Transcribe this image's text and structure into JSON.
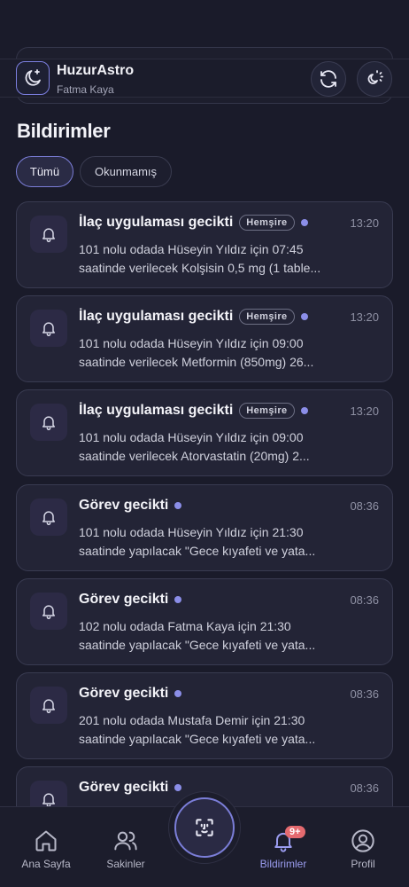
{
  "header": {
    "app_name": "HuzurAstro",
    "user_name": "Fatma Kaya",
    "logo_icon": "moon-star-icon",
    "refresh_icon": "refresh-icon",
    "theme_icon": "sun-moon-icon"
  },
  "page": {
    "title": "Bildirimler",
    "filters": [
      "Tümü",
      "Okunmamış"
    ],
    "active_filter": "Tümü"
  },
  "notifications": [
    {
      "title": "İlaç uygulaması gecikti",
      "tag": "Hemşire",
      "time": "13:20",
      "line1": "101 nolu odada Hüseyin Yıldız için 07:45",
      "line2": "saatinde verilecek Kolşisin 0,5 mg (1 table..."
    },
    {
      "title": "İlaç uygulaması gecikti",
      "tag": "Hemşire",
      "time": "13:20",
      "line1": "101 nolu odada Hüseyin Yıldız için 09:00",
      "line2": "saatinde verilecek Metformin (850mg) 26..."
    },
    {
      "title": "İlaç uygulaması gecikti",
      "tag": "Hemşire",
      "time": "13:20",
      "line1": "101 nolu odada Hüseyin Yıldız için 09:00",
      "line2": "saatinde verilecek Atorvastatin (20mg) 2..."
    },
    {
      "title": "Görev gecikti",
      "tag": "",
      "time": "08:36",
      "line1": "101 nolu odada Hüseyin Yıldız için 21:30",
      "line2": "saatinde yapılacak \"Gece kıyafeti ve yata..."
    },
    {
      "title": "Görev gecikti",
      "tag": "",
      "time": "08:36",
      "line1": "102 nolu odada Fatma Kaya için 21:30",
      "line2": "saatinde yapılacak \"Gece kıyafeti ve yata..."
    },
    {
      "title": "Görev gecikti",
      "tag": "",
      "time": "08:36",
      "line1": "201 nolu odada Mustafa Demir için 21:30",
      "line2": "saatinde yapılacak \"Gece kıyafeti ve yata..."
    },
    {
      "title": "Görev gecikti",
      "tag": "",
      "time": "08:36",
      "line1": "",
      "line2": ""
    }
  ],
  "nav": {
    "home": "Ana Sayfa",
    "residents": "Sakinler",
    "notifications": "Bildirimler",
    "profile": "Profil",
    "badge": "9+",
    "active": "Bildirimler"
  },
  "colors": {
    "background": "#1a1b2a",
    "card": "#232436",
    "accent": "#7b7ed8",
    "badge": "#e46a6f"
  }
}
